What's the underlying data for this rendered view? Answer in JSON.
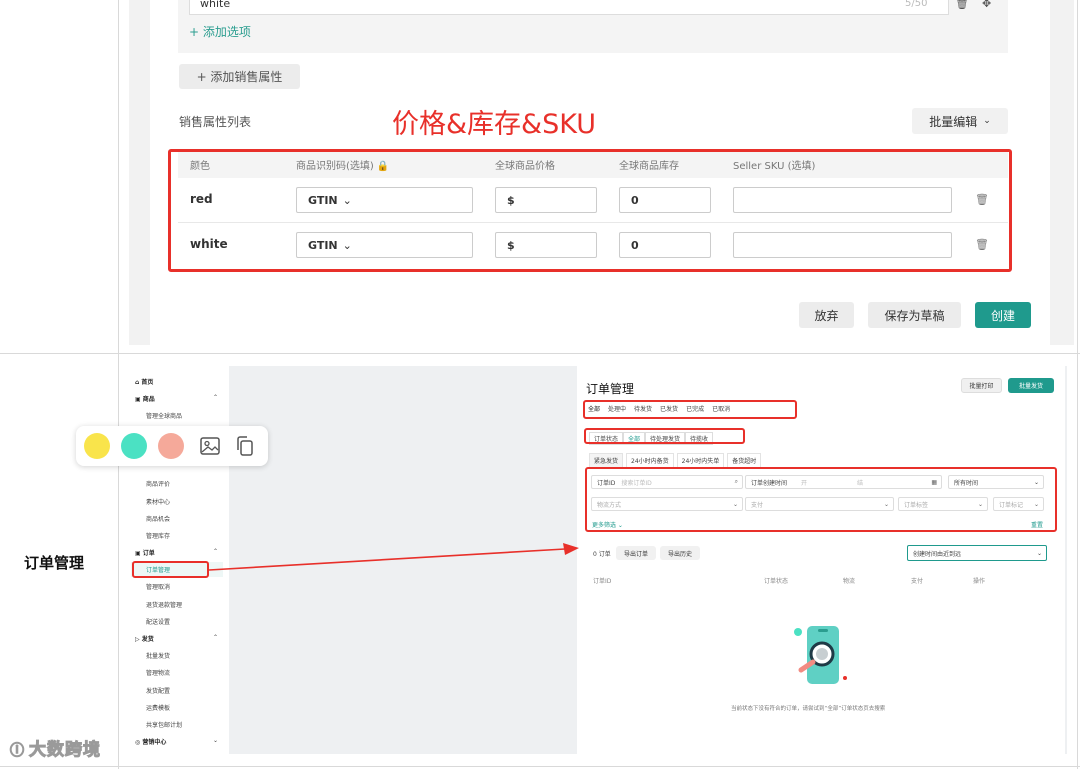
{
  "colors": {
    "accent": "#1f9a8d",
    "annotation_red": "#e8302a",
    "swatches": [
      "#f9e44b",
      "#4be1c3",
      "#f5a99a"
    ]
  },
  "top": {
    "option_value": "white",
    "option_counter": "5/50",
    "add_option": "+ 添加选项",
    "add_sales_attr": "+ 添加销售属性",
    "sales_attr_list": "销售属性列表",
    "annotation": "价格&库存&SKU",
    "bulk_edit": "批量编辑",
    "headers": {
      "color": "颜色",
      "product_id": "商品识别码(选填)",
      "price": "全球商品价格",
      "stock": "全球商品库存",
      "seller_sku": "Seller SKU (选填)"
    },
    "rows": [
      {
        "color": "red",
        "id_type": "GTIN",
        "price": "$",
        "stock": "0",
        "sku": ""
      },
      {
        "color": "white",
        "id_type": "GTIN",
        "price": "$",
        "stock": "0",
        "sku": ""
      }
    ],
    "discard": "放弃",
    "save_draft": "保存为草稿",
    "create": "创建"
  },
  "bottom": {
    "section_label": "订单管理",
    "sidebar": {
      "home": "首页",
      "products": "商品",
      "manage_global": "管理全球商品",
      "reviews": "商品评价",
      "materials": "素材中心",
      "opportunity": "商品机会",
      "inventory": "管理库存",
      "orders": "订单",
      "order_mgmt": "订单管理",
      "cancellations": "管理取消",
      "returns": "退货退款管理",
      "delivery_settings": "配送设置",
      "shipping": "发货",
      "bulk_ship": "批量发货",
      "logistics": "管理物流",
      "ship_config": "发货配置",
      "freight_template": "运费模板",
      "shared_plan": "共享包邮计划",
      "marketing": "营销中心"
    },
    "main": {
      "title": "订单管理",
      "bulk_print": "批量打印",
      "bulk_ship": "批量发货",
      "status_tabs": [
        "全部",
        "处理中",
        "待发货",
        "已发货",
        "已完成",
        "已取消"
      ],
      "sub_tabs": [
        "订单状态",
        "全部",
        "待处理发货",
        "待揽收"
      ],
      "quick_filters": [
        "紧急发货",
        "24小时内备货",
        "24小时内失单",
        "备货超时"
      ],
      "order_id_sel": "订单ID",
      "search_placeholder": "搜索订单ID",
      "created_time_sel": "订单创建时间",
      "date_start": "开",
      "date_end": "结",
      "all_time": "所有时间",
      "logistics_method": "物流方式",
      "payment": "支付",
      "order_tag": "订单标签",
      "order_mark": "订单标记",
      "more_filters": "更多筛选",
      "reset": "重置",
      "order_count": "0 订单",
      "export_orders": "导出订单",
      "export_history": "导出历史",
      "sort": "创建时间由近到远",
      "columns": [
        "订单ID",
        "订单状态",
        "物流",
        "支付",
        "操作"
      ],
      "empty_msg": "当前状态下没有符合的订单，请尝试到“全部”订单状态页去搜索"
    }
  },
  "watermark": "大数跨境"
}
